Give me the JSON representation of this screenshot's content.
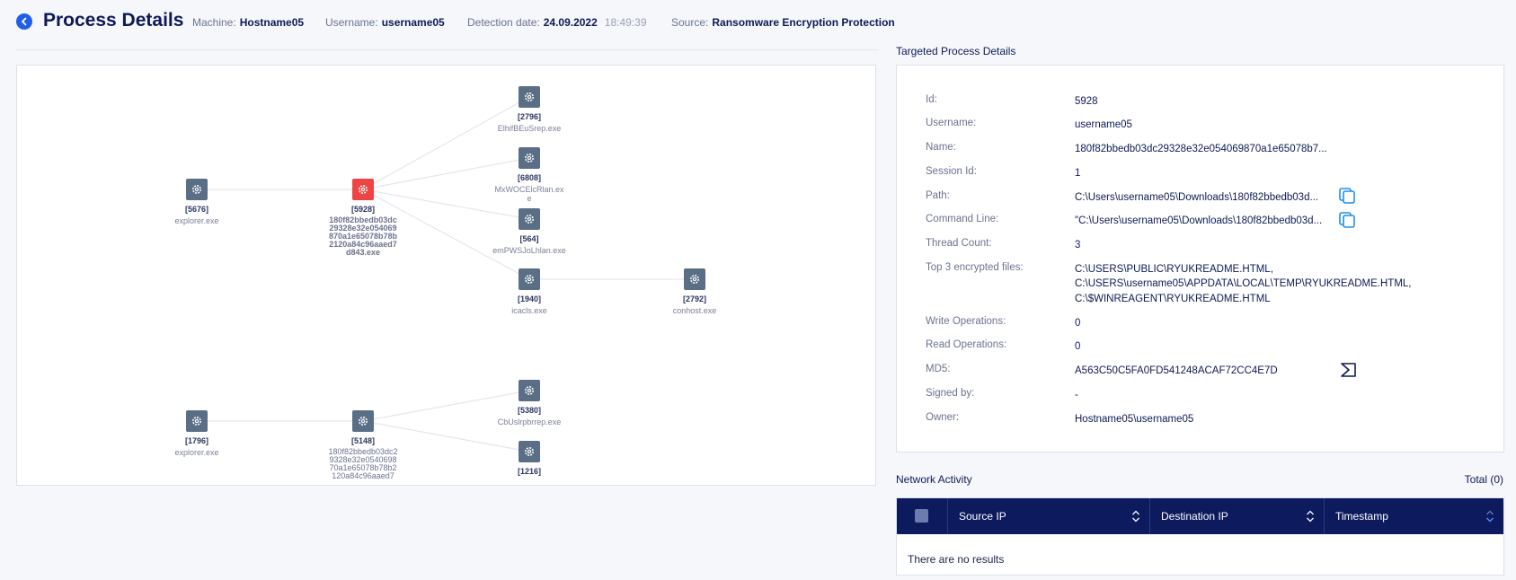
{
  "header": {
    "title": "Process Details",
    "machine_label": "Machine:",
    "machine": "Hostname05",
    "username_label": "Username:",
    "username": "username05",
    "detection_label": "Detection date:",
    "detection_date": "24.09.2022",
    "detection_time": "18:49:39",
    "source_label": "Source:",
    "source": "Ransomware Encryption Protection"
  },
  "graph": {
    "nodes": [
      {
        "pid": "[2796]",
        "name": "ElhifBEuSrep.exe"
      },
      {
        "pid": "[5676]",
        "name": "explorer.exe"
      },
      {
        "pid": "[5928]",
        "name": "180f82bbedb03dc29328e32e054069870a1e65078b78b2120a84c96aaed7d843.exe"
      },
      {
        "pid": "[6808]",
        "name": "MxWOCElcRlan.exe"
      },
      {
        "pid": "[564]",
        "name": "emPWSJoLhlan.exe"
      },
      {
        "pid": "[1940]",
        "name": "icacls.exe"
      },
      {
        "pid": "[2792]",
        "name": "conhost.exe"
      },
      {
        "pid": "[5380]",
        "name": "CbUslrpbrrep.exe"
      },
      {
        "pid": "[1796]",
        "name": "explorer.exe"
      },
      {
        "pid": "[5148]",
        "name": "180f82bbedb03dc29328e32e054069870a1e65078b78b2120a84c96aaed7"
      },
      {
        "pid": "[1216]",
        "name": ""
      }
    ]
  },
  "details": {
    "title": "Targeted Process Details",
    "rows": [
      {
        "label": "Id:",
        "value": "5928"
      },
      {
        "label": "Username:",
        "value": "username05"
      },
      {
        "label": "Name:",
        "value": "180f82bbedb03dc29328e32e054069870a1e65078b7..."
      },
      {
        "label": "Session Id:",
        "value": "1"
      },
      {
        "label": "Path:",
        "value": "C:\\Users\\username05\\Downloads\\180f82bbedb03d..."
      },
      {
        "label": "Command Line:",
        "value": "\"C:\\Users\\username05\\Downloads\\180f82bbedb03d..."
      },
      {
        "label": "Thread Count:",
        "value": "3"
      },
      {
        "label": "Top 3 encrypted files:",
        "value": "C:\\USERS\\PUBLIC\\RYUKREADME.HTML,",
        "value2": "C:\\USERS\\username05\\APPDATA\\LOCAL\\TEMP\\RYUKREADME.HTML,",
        "value3": "C:\\$WINREAGENT\\RYUKREADME.HTML"
      },
      {
        "label": "Write Operations:",
        "value": "0"
      },
      {
        "label": "Read Operations:",
        "value": "0"
      },
      {
        "label": "MD5:",
        "value": "A563C50C5FA0FD541248ACAF72CC4E7D"
      },
      {
        "label": "Signed by:",
        "value": "-"
      },
      {
        "label": "Owner:",
        "value": "Hostname05\\username05"
      }
    ]
  },
  "network": {
    "title": "Network Activity",
    "total": "Total (0)",
    "columns": [
      "Source IP",
      "Destination IP",
      "Timestamp"
    ],
    "empty": "There are no results"
  },
  "colors": {
    "navy": "#0d1a5e",
    "accent": "#1f5fe6",
    "target_node": "#ef4444",
    "node": "#5a6f86"
  }
}
